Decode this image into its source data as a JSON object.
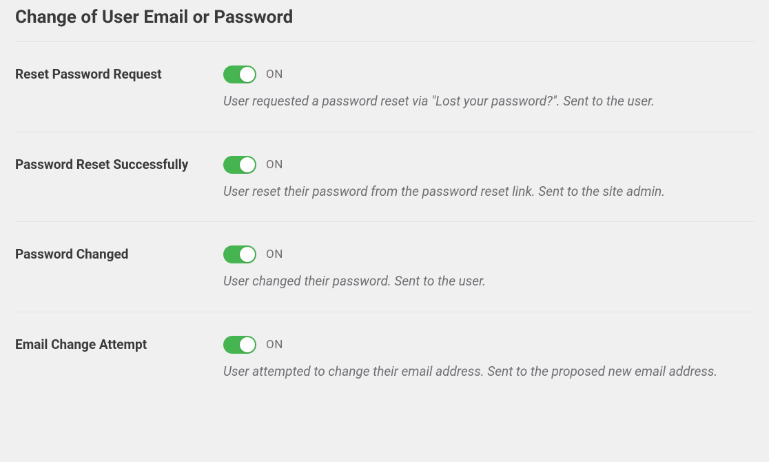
{
  "section": {
    "title": "Change of User Email or Password"
  },
  "settings": [
    {
      "id": "reset-password-request",
      "label": "Reset Password Request",
      "state": "ON",
      "desc": "User requested a password reset via \"Lost your password?\". Sent to the user."
    },
    {
      "id": "password-reset-successfully",
      "label": "Password Reset Successfully",
      "state": "ON",
      "desc": "User reset their password from the password reset link. Sent to the site admin."
    },
    {
      "id": "password-changed",
      "label": "Password Changed",
      "state": "ON",
      "desc": "User changed their password. Sent to the user."
    },
    {
      "id": "email-change-attempt",
      "label": "Email Change Attempt",
      "state": "ON",
      "desc": "User attempted to change their email address. Sent to the proposed new email address."
    }
  ]
}
